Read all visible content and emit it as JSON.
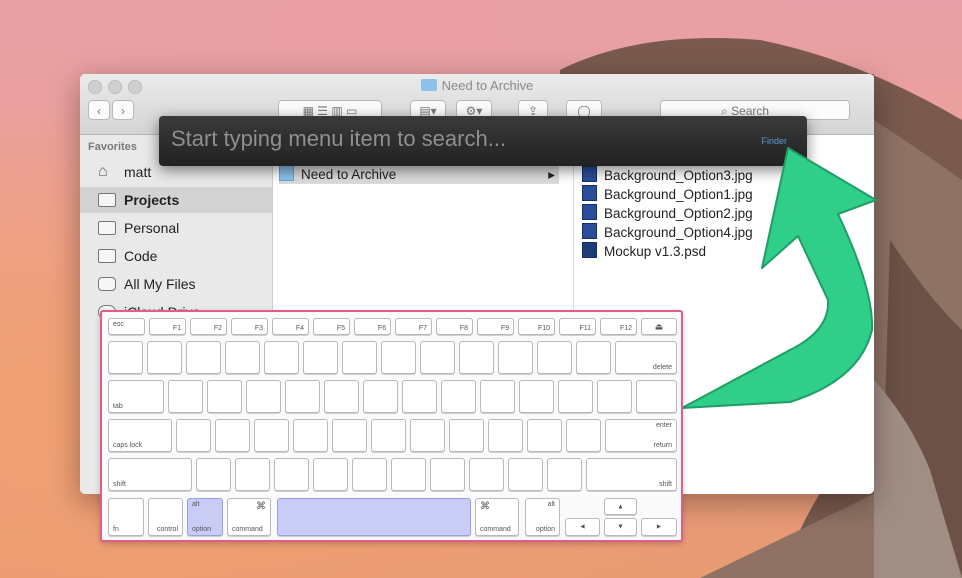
{
  "window": {
    "title": "Need to Archive",
    "search_placeholder": "Search"
  },
  "sidebar": {
    "heading": "Favorites",
    "items": [
      {
        "label": "matt",
        "icon": "home-icon"
      },
      {
        "label": "Projects",
        "icon": "folder-icon",
        "selected": true
      },
      {
        "label": "Personal",
        "icon": "folder-icon"
      },
      {
        "label": "Code",
        "icon": "folder-icon"
      },
      {
        "label": "All My Files",
        "icon": "all-files-icon"
      },
      {
        "label": "iCloud Drive",
        "icon": "cloud-icon"
      }
    ]
  },
  "columns": {
    "col2": [
      {
        "label": "Need to Archive"
      }
    ],
    "col3": [
      {
        "label": "Background_Option3.jpg"
      },
      {
        "label": "Background_Option1.jpg"
      },
      {
        "label": "Background_Option2.jpg"
      },
      {
        "label": "Background_Option4.jpg"
      },
      {
        "label": "Mockup v1.3.psd"
      }
    ]
  },
  "help_search": {
    "placeholder": "Start typing menu item to search...",
    "scope": "Finder"
  },
  "keyboard": {
    "esc": "esc",
    "fkeys": [
      "F1",
      "F2",
      "F3",
      "F4",
      "F5",
      "F6",
      "F7",
      "F8",
      "F9",
      "F10",
      "F11",
      "F12"
    ],
    "eject": "⏏",
    "delete": "delete",
    "tab": "tab",
    "caps_lock": "caps lock",
    "enter": "enter",
    "return": "return",
    "shift": "shift",
    "fn": "fn",
    "control": "control",
    "alt": "alt",
    "option": "option",
    "command": "command",
    "cmd_symbol": "⌘",
    "arrows": {
      "up": "▲",
      "left": "◄",
      "down": "▼",
      "right": "►"
    }
  },
  "colors": {
    "highlight_keys": "#c9cdf6",
    "keyboard_border": "#e15c8c",
    "arrow": "#2fcf8a",
    "search_scope": "#5a9bd5"
  }
}
